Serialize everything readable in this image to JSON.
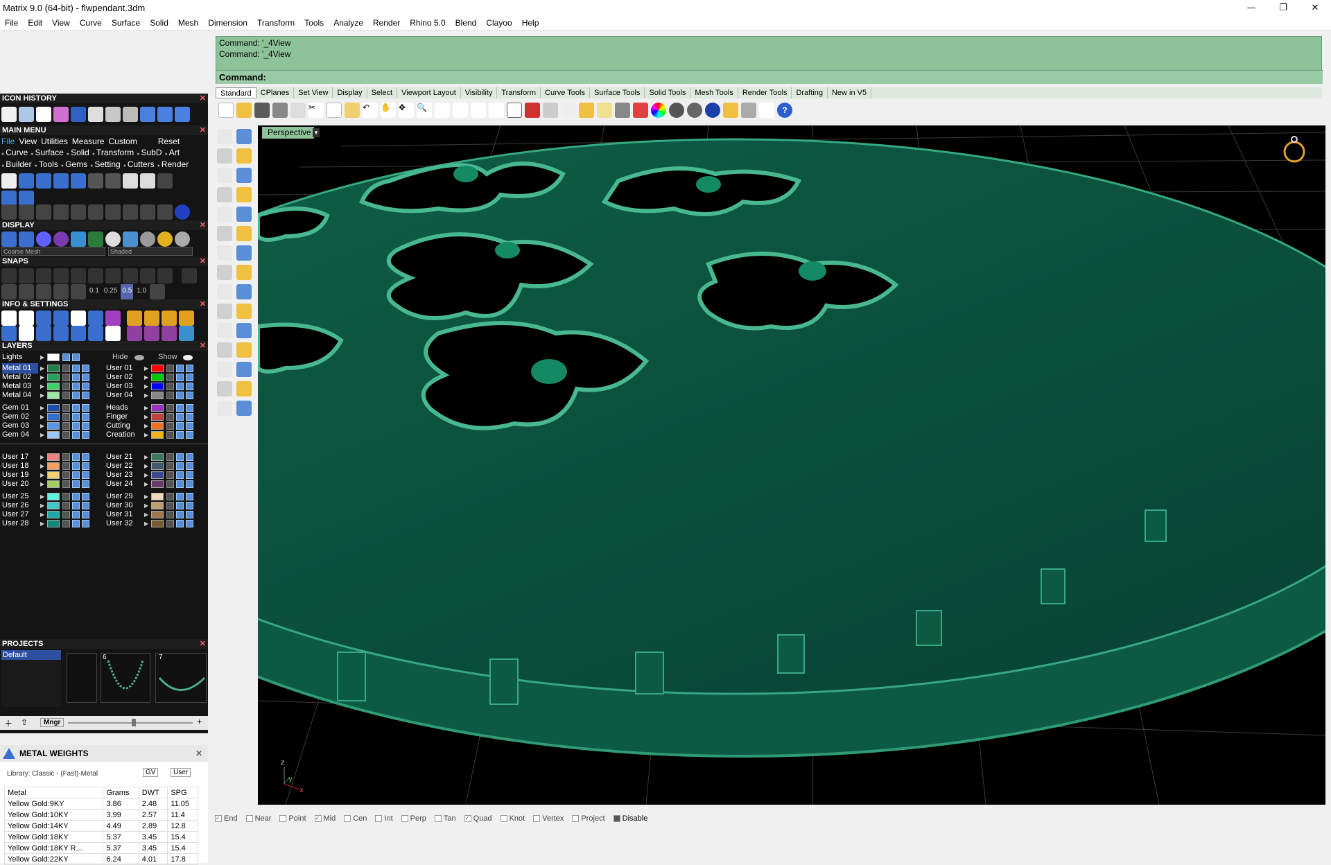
{
  "window": {
    "title": "Matrix 9.0 (64-bit) - flwpendant.3dm",
    "minimize": "—",
    "restore": "❐",
    "close": "✕"
  },
  "menu": [
    "File",
    "Edit",
    "View",
    "Curve",
    "Surface",
    "Solid",
    "Mesh",
    "Dimension",
    "Transform",
    "Tools",
    "Analyze",
    "Render",
    "Rhino 5.0",
    "Blend",
    "Clayoo",
    "Help"
  ],
  "panels": {
    "icon_history": "ICON HISTORY",
    "main_menu": "MAIN MENU",
    "main_tabs": [
      "File",
      "View",
      "Utilities",
      "Measure",
      "Custom"
    ],
    "reset": "Reset",
    "cats_row1": [
      "Curve",
      "Surface",
      "Solid",
      "Transform",
      "SubD",
      "Art"
    ],
    "cats_row2": [
      "Builder",
      "Tools",
      "Gems",
      "Setting",
      "Cutters",
      "Render"
    ],
    "display": "DISPLAY",
    "mesh_mode": "Coarse Mesh",
    "shade_mode": "Shaded",
    "snaps": "SNAPS",
    "snap_values": [
      "0.1",
      "0.25",
      "0.5",
      "1.0"
    ],
    "info_settings": "INFO & SETTINGS",
    "layers": "LAYERS",
    "lights": "Lights",
    "hide": "Hide",
    "show": "Show",
    "projects": "PROJECTS",
    "project_default": "Default",
    "project_nums": [
      "6",
      "7"
    ],
    "mngr": "Mngr",
    "metal_weights": "METAL WEIGHTS",
    "library": "Library: Classic - (Fast)-Metal",
    "gv": "GV",
    "user": "User"
  },
  "layers_left": [
    {
      "name": "Metal 01",
      "color": "#1e7f4a",
      "sel": true
    },
    {
      "name": "Metal 02",
      "color": "#26a05a"
    },
    {
      "name": "Metal 03",
      "color": "#3fd06a"
    },
    {
      "name": "Metal 04",
      "color": "#9ee8a8"
    },
    {
      "name": "Gem 01",
      "color": "#1d4fa8"
    },
    {
      "name": "Gem 02",
      "color": "#2f6fd0"
    },
    {
      "name": "Gem 03",
      "color": "#5a96e8"
    },
    {
      "name": "Gem 04",
      "color": "#9cc4f4"
    },
    {
      "name": "User 17",
      "color": "#f08080"
    },
    {
      "name": "User 18",
      "color": "#f4a060"
    },
    {
      "name": "User 19",
      "color": "#f0d070"
    },
    {
      "name": "User 20",
      "color": "#a0d060"
    },
    {
      "name": "User 25",
      "color": "#60f0e0"
    },
    {
      "name": "User 26",
      "color": "#40c8c8"
    },
    {
      "name": "User 27",
      "color": "#20a8a8"
    },
    {
      "name": "User 28",
      "color": "#108878"
    }
  ],
  "layers_right": [
    {
      "name": "User 01",
      "color": "#ff0000"
    },
    {
      "name": "User 02",
      "color": "#00c800"
    },
    {
      "name": "User 03",
      "color": "#0000ff"
    },
    {
      "name": "User 04",
      "color": "#888888"
    },
    {
      "name": "Heads",
      "color": "#9a30c0"
    },
    {
      "name": "Finger",
      "color": "#c04040"
    },
    {
      "name": "Cutting",
      "color": "#f07020"
    },
    {
      "name": "Creation",
      "color": "#f0b020"
    },
    {
      "name": "User 21",
      "color": "#3a7a5a"
    },
    {
      "name": "User 22",
      "color": "#405a70"
    },
    {
      "name": "User 23",
      "color": "#3a4a8a"
    },
    {
      "name": "User 24",
      "color": "#6a3a6a"
    },
    {
      "name": "User 29",
      "color": "#f0d8b8"
    },
    {
      "name": "User 30",
      "color": "#c0a070"
    },
    {
      "name": "User 31",
      "color": "#a07850"
    },
    {
      "name": "User 32",
      "color": "#7a5a30"
    }
  ],
  "metal_table": {
    "headers": [
      "Metal",
      "Grams",
      "DWT",
      "SPG"
    ],
    "rows": [
      [
        "Yellow Gold:9KY",
        "3.86",
        "2.48",
        "11.05"
      ],
      [
        "Yellow Gold:10KY",
        "3.99",
        "2.57",
        "11.4"
      ],
      [
        "Yellow Gold:14KY",
        "4.49",
        "2.89",
        "12.8"
      ],
      [
        "Yellow Gold:18KY",
        "5.37",
        "3.45",
        "15.4"
      ],
      [
        "Yellow Gold:18KY R...",
        "5.37",
        "3.45",
        "15.4"
      ],
      [
        "Yellow Gold:22KY",
        "6.24",
        "4.01",
        "17.8"
      ]
    ]
  },
  "command": {
    "history": [
      "Command: '_4View",
      "Command: '_4View"
    ],
    "prompt": "Command:"
  },
  "tabs": [
    "Standard",
    "CPlanes",
    "Set View",
    "Display",
    "Select",
    "Viewport Layout",
    "Visibility",
    "Transform",
    "Curve Tools",
    "Surface Tools",
    "Solid Tools",
    "Mesh Tools",
    "Render Tools",
    "Drafting",
    "New in V5"
  ],
  "viewport": {
    "label": "Perspective"
  },
  "osnaps": [
    {
      "label": "End",
      "on": true
    },
    {
      "label": "Near",
      "on": false
    },
    {
      "label": "Point",
      "on": false
    },
    {
      "label": "Mid",
      "on": true
    },
    {
      "label": "Cen",
      "on": false
    },
    {
      "label": "Int",
      "on": false
    },
    {
      "label": "Perp",
      "on": false
    },
    {
      "label": "Tan",
      "on": false
    },
    {
      "label": "Quad",
      "on": true
    },
    {
      "label": "Knot",
      "on": false
    },
    {
      "label": "Vertex",
      "on": false
    },
    {
      "label": "Project",
      "on": false
    },
    {
      "label": "Disable",
      "on": false
    }
  ],
  "axis": {
    "x": "x",
    "y": "y",
    "z": "z"
  }
}
